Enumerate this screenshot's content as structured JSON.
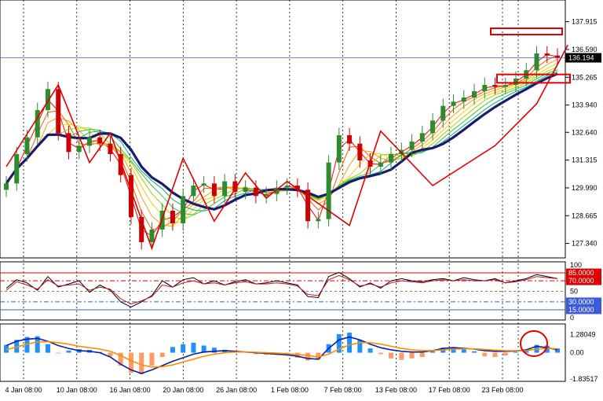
{
  "colors": {
    "background": "#ffffff",
    "frame": "#000000",
    "grid": "#000000",
    "candle_up": "#2e8b2e",
    "candle_down": "#cc0000",
    "ma_thick": "#1a1a6e",
    "ribbon": [
      "#ff0000",
      "#ff5a00",
      "#ff9d00",
      "#f2d200",
      "#9fd400",
      "#3fbf3f",
      "#00b27d"
    ],
    "zigzag": "#e00000",
    "current_price_line": "#3b5bdb",
    "price_box": "#000000",
    "level_high": "#e00000",
    "level_low": "#3b5bdb",
    "level_mid": "#808080",
    "macd_up": "#1e90ff",
    "macd_down": "#ff9966",
    "macd_line": "#0b1f9c",
    "signal_line": "#ff8c00",
    "annotation": "#e00000"
  },
  "chart_data": [
    {
      "type": "candlestick",
      "panel": "price",
      "y_ticks": [
        "137.915",
        "136.590",
        "135.265",
        "133.940",
        "132.640",
        "131.315",
        "129.990",
        "128.665",
        "127.340"
      ],
      "ylim": [
        126.8,
        138.8
      ],
      "current_price": "136.194",
      "x_ticks": [
        "4 Jan 08:00",
        "10 Jan 08:00",
        "16 Jan 08:00",
        "20 Jan 08:00",
        "26 Jan 08:00",
        "1 Feb 08:00",
        "7 Feb 08:00",
        "13 Feb 08:00",
        "17 Feb 08:00",
        "23 Feb 08:00"
      ],
      "closes_sampled": [
        130.2,
        131.6,
        132.4,
        133.7,
        134.7,
        132.6,
        131.7,
        132.0,
        132.4,
        132.1,
        131.6,
        130.6,
        128.6,
        127.4,
        128.0,
        128.9,
        128.3,
        129.6,
        130.1,
        130.2,
        129.6,
        130.3,
        129.8,
        130.0,
        129.6,
        129.7,
        130.0,
        130.1,
        129.9,
        128.4,
        128.5,
        131.2,
        132.5,
        132.1,
        131.3,
        131.0,
        131.2,
        131.6,
        131.8,
        132.2,
        132.6,
        133.2,
        133.9,
        134.1,
        134.3,
        134.6,
        134.9,
        134.8,
        134.9,
        135.2,
        135.6,
        136.4,
        136.3,
        136.2
      ],
      "zigzag": [
        {
          "i": 0,
          "v": 131.0
        },
        {
          "i": 5,
          "v": 134.9
        },
        {
          "i": 8,
          "v": 131.2
        },
        {
          "i": 10,
          "v": 132.6
        },
        {
          "i": 14,
          "v": 127.1
        },
        {
          "i": 17,
          "v": 131.4
        },
        {
          "i": 20,
          "v": 128.4
        },
        {
          "i": 23,
          "v": 130.7
        },
        {
          "i": 25,
          "v": 129.5
        },
        {
          "i": 27,
          "v": 130.3
        },
        {
          "i": 33,
          "v": 128.2
        },
        {
          "i": 36,
          "v": 132.7
        },
        {
          "i": 41,
          "v": 130.1
        },
        {
          "i": 47,
          "v": 132.0
        },
        {
          "i": 51,
          "v": 134.0
        },
        {
          "i": 54,
          "v": 136.8
        }
      ],
      "annotated_boxes": [
        {
          "label": "",
          "price_top": 137.6,
          "price_bottom": 137.3
        },
        {
          "label": "",
          "price_top": 135.4,
          "price_bottom": 135.0
        }
      ]
    },
    {
      "type": "line",
      "panel": "oscillator",
      "y_ticks": [
        "100",
        "85.0000",
        "70.0000",
        "50",
        "30.0000",
        "15.0000",
        "0"
      ],
      "levels": [
        85,
        70,
        50,
        30,
        15
      ],
      "ylim": [
        0,
        100
      ],
      "series": [
        {
          "values": [
            56,
            72,
            66,
            52,
            78,
            58,
            64,
            70,
            48,
            62,
            52,
            30,
            20,
            30,
            42,
            70,
            58,
            72,
            76,
            64,
            70,
            62,
            68,
            72,
            64,
            66,
            70,
            66,
            62,
            40,
            38,
            78,
            86,
            74,
            58,
            66,
            56,
            70,
            74,
            70,
            68,
            72,
            74,
            70,
            76,
            72,
            70,
            74,
            66,
            70,
            74,
            82,
            78,
            74
          ]
        },
        {
          "values": [
            52,
            68,
            62,
            54,
            72,
            60,
            62,
            64,
            52,
            58,
            54,
            36,
            26,
            32,
            40,
            62,
            58,
            66,
            70,
            64,
            66,
            62,
            66,
            68,
            64,
            64,
            66,
            64,
            60,
            44,
            42,
            72,
            80,
            72,
            60,
            64,
            58,
            66,
            70,
            68,
            66,
            70,
            72,
            70,
            72,
            70,
            70,
            72,
            66,
            68,
            72,
            78,
            76,
            74
          ]
        }
      ]
    },
    {
      "type": "bar",
      "panel": "macd",
      "y_ticks": [
        "1.28049",
        "0.00",
        "-1.83517"
      ],
      "ylim": [
        -1.83517,
        1.9
      ],
      "histogram": [
        0.55,
        0.9,
        1.1,
        1.15,
        0.6,
        -0.05,
        0.15,
        0.25,
        0.2,
        0.05,
        -0.25,
        -0.9,
        -1.4,
        -1.5,
        -0.9,
        -0.3,
        0.4,
        0.6,
        0.7,
        0.5,
        0.35,
        0.2,
        0.1,
        0.05,
        -0.1,
        -0.15,
        -0.1,
        -0.2,
        -0.35,
        -0.55,
        -0.5,
        0.6,
        1.3,
        1.4,
        0.9,
        0.3,
        -0.1,
        -0.4,
        -0.5,
        -0.4,
        -0.3,
        0.1,
        0.35,
        0.4,
        0.3,
        0.1,
        -0.25,
        -0.3,
        -0.2,
        0.05,
        0.2,
        0.55,
        0.5,
        0.3
      ],
      "series": [
        {
          "values": [
            0.5,
            0.8,
            0.95,
            1.0,
            0.8,
            0.5,
            0.3,
            0.15,
            0.1,
            0.0,
            -0.3,
            -0.8,
            -1.2,
            -1.45,
            -1.2,
            -0.9,
            -0.6,
            -0.35,
            -0.1,
            0.05,
            0.1,
            0.15,
            0.1,
            0.05,
            0.0,
            -0.05,
            -0.1,
            -0.15,
            -0.25,
            -0.4,
            -0.45,
            0.3,
            0.9,
            1.1,
            0.9,
            0.6,
            0.35,
            0.2,
            0.1,
            0.05,
            0.05,
            0.15,
            0.3,
            0.35,
            0.3,
            0.25,
            0.15,
            0.1,
            0.1,
            0.12,
            0.2,
            0.45,
            0.35,
            0.2
          ]
        },
        {
          "values": [
            0.2,
            0.4,
            0.6,
            0.75,
            0.78,
            0.7,
            0.6,
            0.45,
            0.35,
            0.25,
            0.1,
            -0.2,
            -0.55,
            -0.85,
            -1.0,
            -0.98,
            -0.85,
            -0.65,
            -0.45,
            -0.25,
            -0.1,
            0.0,
            0.05,
            0.05,
            0.03,
            0.0,
            -0.03,
            -0.07,
            -0.12,
            -0.2,
            -0.3,
            -0.1,
            0.25,
            0.55,
            0.7,
            0.7,
            0.6,
            0.45,
            0.3,
            0.2,
            0.15,
            0.15,
            0.2,
            0.25,
            0.27,
            0.27,
            0.23,
            0.18,
            0.15,
            0.14,
            0.15,
            0.25,
            0.3,
            0.28
          ]
        }
      ]
    }
  ]
}
